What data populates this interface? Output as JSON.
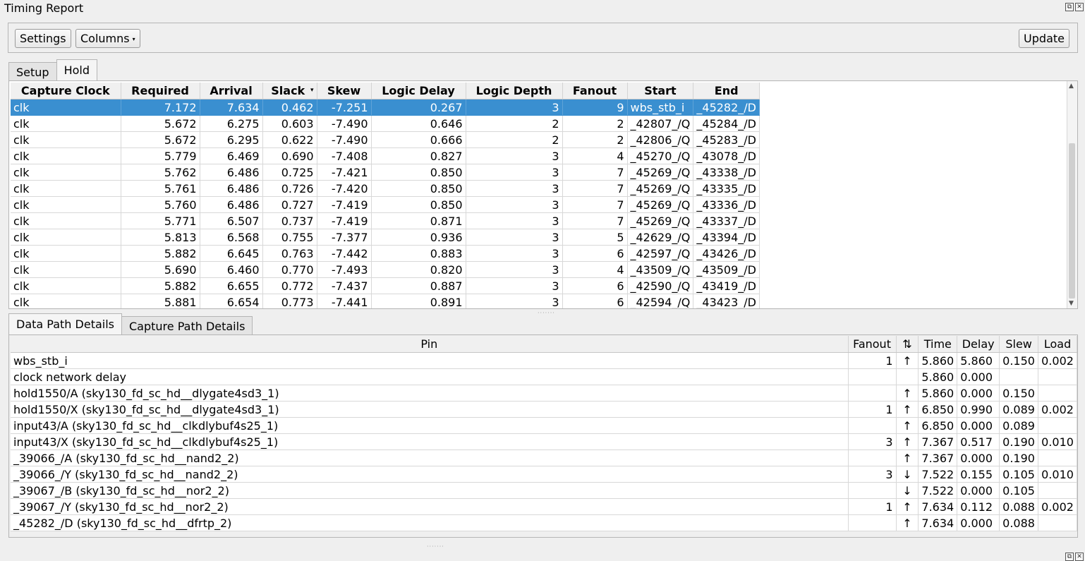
{
  "window": {
    "title": "Timing Report"
  },
  "toolbar": {
    "settings_label": "Settings",
    "columns_label": "Columns",
    "update_label": "Update"
  },
  "path_tabs": [
    {
      "label": "Setup",
      "active": false
    },
    {
      "label": "Hold",
      "active": true
    }
  ],
  "timing_table": {
    "headers": [
      "Capture Clock",
      "Required",
      "Arrival",
      "Slack",
      "Skew",
      "Logic Delay",
      "Logic Depth",
      "Fanout",
      "Start",
      "End"
    ],
    "sorted_column": "Slack",
    "rows": [
      [
        "clk",
        "7.172",
        "7.634",
        "0.462",
        "-7.251",
        "0.267",
        "3",
        "9",
        "wbs_stb_i",
        "_45282_/D"
      ],
      [
        "clk",
        "5.672",
        "6.275",
        "0.603",
        "-7.490",
        "0.646",
        "2",
        "2",
        "_42807_/Q",
        "_45284_/D"
      ],
      [
        "clk",
        "5.672",
        "6.295",
        "0.622",
        "-7.490",
        "0.666",
        "2",
        "2",
        "_42806_/Q",
        "_45283_/D"
      ],
      [
        "clk",
        "5.779",
        "6.469",
        "0.690",
        "-7.408",
        "0.827",
        "3",
        "4",
        "_45270_/Q",
        "_43078_/D"
      ],
      [
        "clk",
        "5.762",
        "6.486",
        "0.725",
        "-7.421",
        "0.850",
        "3",
        "7",
        "_45269_/Q",
        "_43338_/D"
      ],
      [
        "clk",
        "5.761",
        "6.486",
        "0.726",
        "-7.420",
        "0.850",
        "3",
        "7",
        "_45269_/Q",
        "_43335_/D"
      ],
      [
        "clk",
        "5.760",
        "6.486",
        "0.727",
        "-7.419",
        "0.850",
        "3",
        "7",
        "_45269_/Q",
        "_43336_/D"
      ],
      [
        "clk",
        "5.771",
        "6.507",
        "0.737",
        "-7.419",
        "0.871",
        "3",
        "7",
        "_45269_/Q",
        "_43337_/D"
      ],
      [
        "clk",
        "5.813",
        "6.568",
        "0.755",
        "-7.377",
        "0.936",
        "3",
        "5",
        "_42629_/Q",
        "_43394_/D"
      ],
      [
        "clk",
        "5.882",
        "6.645",
        "0.763",
        "-7.442",
        "0.883",
        "3",
        "6",
        "_42597_/Q",
        "_43426_/D"
      ],
      [
        "clk",
        "5.690",
        "6.460",
        "0.770",
        "-7.493",
        "0.820",
        "3",
        "4",
        "_43509_/Q",
        "_43509_/D"
      ],
      [
        "clk",
        "5.882",
        "6.655",
        "0.772",
        "-7.437",
        "0.887",
        "3",
        "6",
        "_42590_/Q",
        "_43419_/D"
      ],
      [
        "clk",
        "5.881",
        "6.654",
        "0.773",
        "-7.441",
        "0.891",
        "3",
        "6",
        "_42594_/Q",
        "_43423_/D"
      ]
    ],
    "selected_row": 0
  },
  "detail_tabs": [
    {
      "label": "Data Path Details",
      "active": true
    },
    {
      "label": "Capture Path Details",
      "active": false
    }
  ],
  "details_table": {
    "headers": [
      "Pin",
      "Fanout",
      "⇅",
      "Time",
      "Delay",
      "Slew",
      "Load"
    ],
    "rows": [
      [
        "wbs_stb_i",
        "1",
        "↑",
        "5.860",
        "5.860",
        "0.150",
        "0.002"
      ],
      [
        "clock network delay",
        "",
        "",
        "5.860",
        "0.000",
        "",
        ""
      ],
      [
        "hold1550/A (sky130_fd_sc_hd__dlygate4sd3_1)",
        "",
        "↑",
        "5.860",
        "0.000",
        "0.150",
        ""
      ],
      [
        "hold1550/X (sky130_fd_sc_hd__dlygate4sd3_1)",
        "1",
        "↑",
        "6.850",
        "0.990",
        "0.089",
        "0.002"
      ],
      [
        "input43/A (sky130_fd_sc_hd__clkdlybuf4s25_1)",
        "",
        "↑",
        "6.850",
        "0.000",
        "0.089",
        ""
      ],
      [
        "input43/X (sky130_fd_sc_hd__clkdlybuf4s25_1)",
        "3",
        "↑",
        "7.367",
        "0.517",
        "0.190",
        "0.010"
      ],
      [
        "_39066_/A (sky130_fd_sc_hd__nand2_2)",
        "",
        "↑",
        "7.367",
        "0.000",
        "0.190",
        ""
      ],
      [
        "_39066_/Y (sky130_fd_sc_hd__nand2_2)",
        "3",
        "↓",
        "7.522",
        "0.155",
        "0.105",
        "0.010"
      ],
      [
        "_39067_/B (sky130_fd_sc_hd__nor2_2)",
        "",
        "↓",
        "7.522",
        "0.000",
        "0.105",
        ""
      ],
      [
        "_39067_/Y (sky130_fd_sc_hd__nor2_2)",
        "1",
        "↑",
        "7.634",
        "0.112",
        "0.088",
        "0.002"
      ],
      [
        "_45282_/D (sky130_fd_sc_hd__dfrtp_2)",
        "",
        "↑",
        "7.634",
        "0.000",
        "0.088",
        ""
      ]
    ]
  },
  "colors": {
    "selection": "#3a8fd0",
    "background": "#efefef"
  }
}
